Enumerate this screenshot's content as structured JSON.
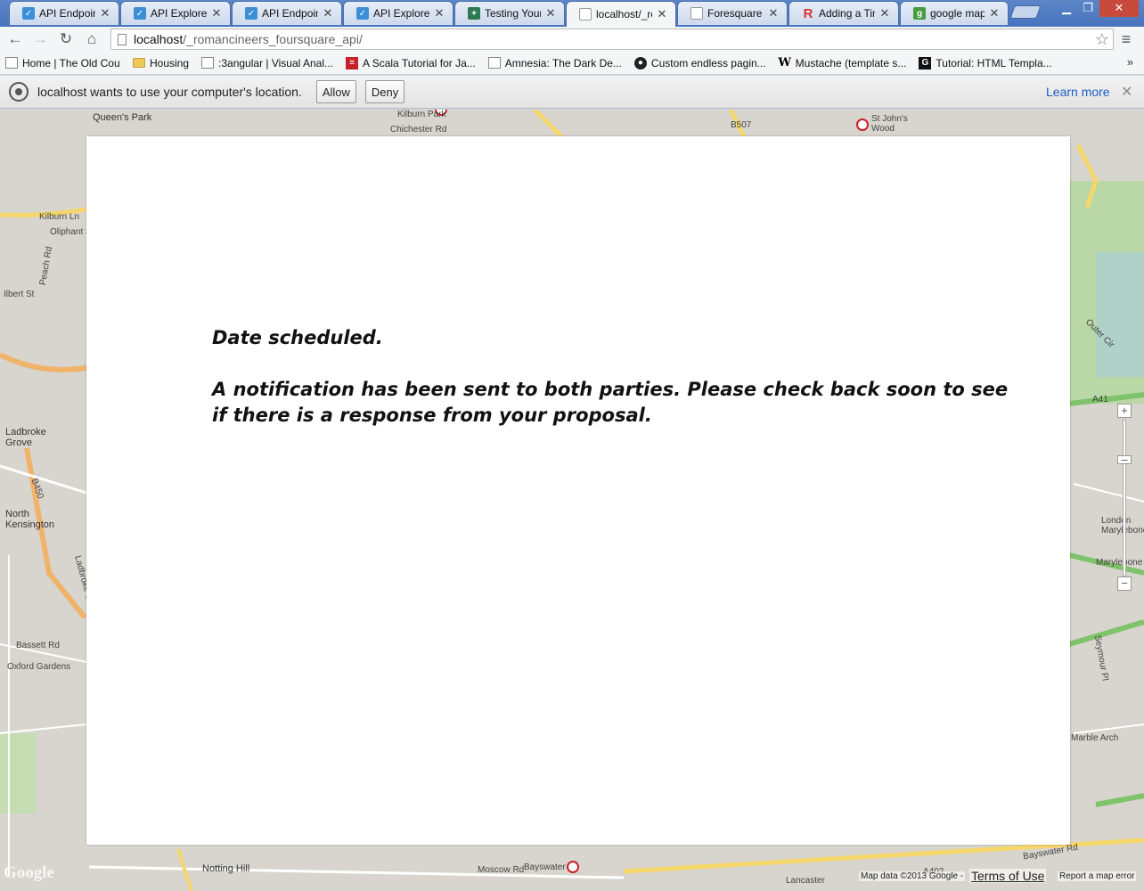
{
  "tabs": [
    {
      "title": "API Endpoints",
      "icon": "api-icon",
      "active": false
    },
    {
      "title": "API Explorer",
      "icon": "api-icon",
      "active": false
    },
    {
      "title": "API Endpoints",
      "icon": "api-icon",
      "active": false
    },
    {
      "title": "API Explorer",
      "icon": "api-icon",
      "active": false
    },
    {
      "title": "Testing Your J",
      "icon": "doc-icon",
      "active": false
    },
    {
      "title": "localhost/_rom",
      "icon": "page-icon",
      "active": true
    },
    {
      "title": "Foresquare ex",
      "icon": "page-icon",
      "active": false
    },
    {
      "title": "Adding a Time",
      "icon": "r-icon",
      "active": false
    },
    {
      "title": "google map lo",
      "icon": "google-maps-icon",
      "active": false
    }
  ],
  "omnibox": {
    "url_host": "localhost",
    "url_path": "/_romancineers_foursquare_api/"
  },
  "bookmarks": [
    {
      "label": "Home | The Old Count",
      "icon": "page-icon"
    },
    {
      "label": "Housing",
      "icon": "folder-icon"
    },
    {
      "label": ":3angular | Visual Anal...",
      "icon": "page-icon"
    },
    {
      "label": "A Scala Tutorial for Ja...",
      "icon": "scala-icon"
    },
    {
      "label": "Amnesia: The Dark De...",
      "icon": "page-icon"
    },
    {
      "label": "Custom endless pagin...",
      "icon": "github-icon"
    },
    {
      "label": "Mustache (template s...",
      "icon": "wikipedia-icon"
    },
    {
      "label": "Tutorial: HTML Templa...",
      "icon": "g-icon"
    }
  ],
  "bookmarks_more": "»",
  "infobar": {
    "message": "localhost wants to use your computer's location.",
    "allow_label": "Allow",
    "deny_label": "Deny",
    "learn_more": "Learn more"
  },
  "modal": {
    "heading": "Date scheduled.",
    "body": "A notification has been sent to both parties. Please check back soon to see if there is a response from your proposal."
  },
  "map": {
    "labels": [
      "Queen's Park",
      "Kilburn Ln",
      "Oliphant St",
      "Peach Rd",
      "Ilbert St",
      "Ladbroke Grove",
      "North Kensington",
      "B450",
      "Ladbroke Grove",
      "Bassett Rd",
      "Oxford Gardens",
      "Notting Hill",
      "Bayswater",
      "Moscow Rd",
      "St John's Wood",
      "London Marylebone",
      "Marylebone",
      "Seymour Pl",
      "Marble Arch",
      "Bayswater Rd",
      "Kilburn Park",
      "Chichester Rd",
      "A41",
      "B507",
      "A402",
      "Lancaster",
      "Outer Cir"
    ],
    "attribution": "Map data ©2013 Google -",
    "terms": "Terms of Use",
    "report": "Report a map error",
    "logo": "Google"
  }
}
